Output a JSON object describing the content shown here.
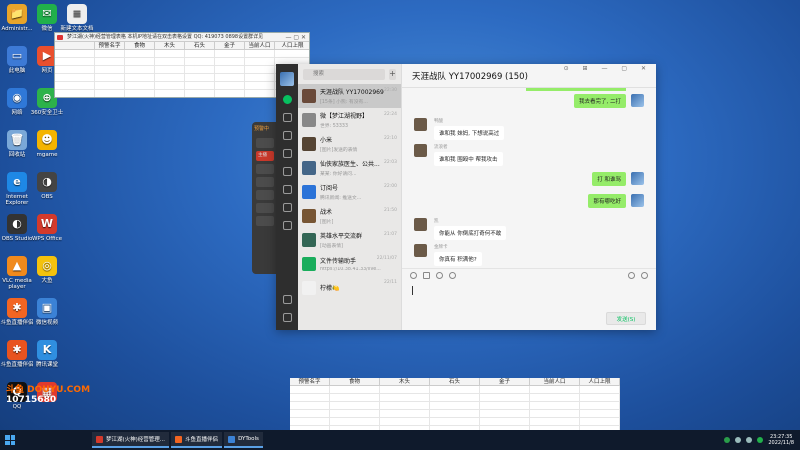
{
  "desktop": {
    "icons": [
      {
        "label": "Administr...",
        "color": "#e8a52a",
        "glyph": "📁"
      },
      {
        "label": "此电脑",
        "color": "#3d7ad6",
        "glyph": "▭"
      },
      {
        "label": "网络",
        "color": "#2f78d8",
        "glyph": "◉"
      },
      {
        "label": "回收站",
        "color": "#7aa8d8",
        "glyph": "🗑"
      },
      {
        "label": "Internet Explorer",
        "color": "#1e88e5",
        "glyph": "e"
      },
      {
        "label": "OBS Studio",
        "color": "#333333",
        "glyph": "◐"
      },
      {
        "label": "VLC media player",
        "color": "#f08a1d",
        "glyph": "▲"
      },
      {
        "label": "斗鱼直播伴侣",
        "color": "#f26522",
        "glyph": "✱"
      },
      {
        "label": "斗鱼直播伴侣",
        "color": "#e8531f",
        "glyph": "✱"
      },
      {
        "label": "QQ",
        "color": "#111111",
        "glyph": "Q"
      }
    ],
    "icons_col2": [
      {
        "label": "微信",
        "color": "#21b04b",
        "glyph": "✉"
      },
      {
        "label": "网页",
        "color": "#e94f2e",
        "glyph": "▶"
      },
      {
        "label": "360安全卫士",
        "color": "#2db24a",
        "glyph": "⊕"
      },
      {
        "label": "mgame",
        "color": "#f4b400",
        "glyph": "☻"
      },
      {
        "label": "OBS",
        "color": "#444444",
        "glyph": "◑"
      },
      {
        "label": "WPS Office",
        "color": "#d33a2c",
        "glyph": "W"
      },
      {
        "label": "大鱼",
        "color": "#f4c20d",
        "glyph": "◎"
      },
      {
        "label": "微信视频",
        "color": "#3b82d6",
        "glyph": "▣"
      },
      {
        "label": "腾讯课堂",
        "color": "#2f8fe0",
        "glyph": "K"
      },
      {
        "label": "",
        "color": "#e03a2e",
        "glyph": "▦"
      }
    ],
    "icon_col3": {
      "label": "新建文本文档",
      "color": "#eeeeee",
      "glyph": "≡"
    },
    "watermark_id": "10715680"
  },
  "sheet_top": {
    "title": "梦江湖(火神)经营管理表格   本机IP地址请在双击表格设置  QQ: 419073 0898设置群详见",
    "headers": [
      "预警名字",
      "食物",
      "木头",
      "石头",
      "金子",
      "当前人口",
      "人口上限"
    ]
  },
  "sheet_bottom": {
    "headers": [
      "预警名字",
      "食物",
      "木头",
      "石头",
      "金子",
      "当前人口",
      "人口上限"
    ]
  },
  "dark_panel": {
    "title": "预警中",
    "buttons": [
      "",
      "主播",
      "",
      "",
      "",
      "",
      ""
    ]
  },
  "wechat": {
    "search_placeholder": "搜索",
    "chat_title": "天涯战队 YY17002969 (150)",
    "send_label": "发送(S)",
    "conversations": [
      {
        "name": "天涯战队 YY17002969",
        "preview": "[15条] 小熊: 有没有...",
        "time": "22:30",
        "color": "#6a4a3a"
      },
      {
        "name": "微【梦江湖视野】",
        "preview": "世界: 53333",
        "time": "22:24",
        "color": "#888888"
      },
      {
        "name": "小米",
        "preview": "[图片]发送的表情",
        "time": "22:10",
        "color": "#554433"
      },
      {
        "name": "仙侠家族医生、公共...",
        "preview": "某某: 你好请问...",
        "time": "22:03",
        "color": "#446688"
      },
      {
        "name": "订阅号",
        "preview": "腾讯新闻: 推送文...",
        "time": "22:00",
        "color": "#2b73d8"
      },
      {
        "name": "战术",
        "preview": "[图片]",
        "time": "21:50",
        "color": "#775533"
      },
      {
        "name": "英雄水平交流群",
        "preview": "[动画表情]",
        "time": "21:07",
        "color": "#336655"
      },
      {
        "name": "文件传输助手",
        "preview": "https://10.38.41.33/live...",
        "time": "22/11/07",
        "color": "#1aad5c"
      },
      {
        "name": "柠檬🍋",
        "preview": "",
        "time": "22/11",
        "color": "#f1f1f1"
      }
    ],
    "messages": [
      {
        "dir": "out",
        "nick": "",
        "text": "我去看完了, 二打"
      },
      {
        "dir": "in",
        "nick": "鸭酸",
        "text": "谁和我 妹妈, 下想说高过"
      },
      {
        "dir": "in",
        "nick": "流浪者",
        "text": "谁和我 围殴中 帮我攻击"
      },
      {
        "dir": "out",
        "nick": "",
        "text": "打 和谁骂"
      },
      {
        "dir": "out",
        "nick": "",
        "text": "那有哪吃好"
      },
      {
        "dir": "in",
        "nick": "凯",
        "text": "你能从 你倒底打奇何不敢"
      },
      {
        "dir": "in",
        "nick": "金牌卡",
        "text": "你真有 积满他?"
      }
    ]
  },
  "taskbar": {
    "tasks": [
      {
        "label": "梦江湖(火神)经营管理...",
        "color": "#d33a2c"
      },
      {
        "label": "斗鱼直播伴侣",
        "color": "#f26522"
      },
      {
        "label": "DYTools",
        "color": "#3b82d6"
      }
    ],
    "time": "23:27:35",
    "date": "2022/11/8"
  }
}
